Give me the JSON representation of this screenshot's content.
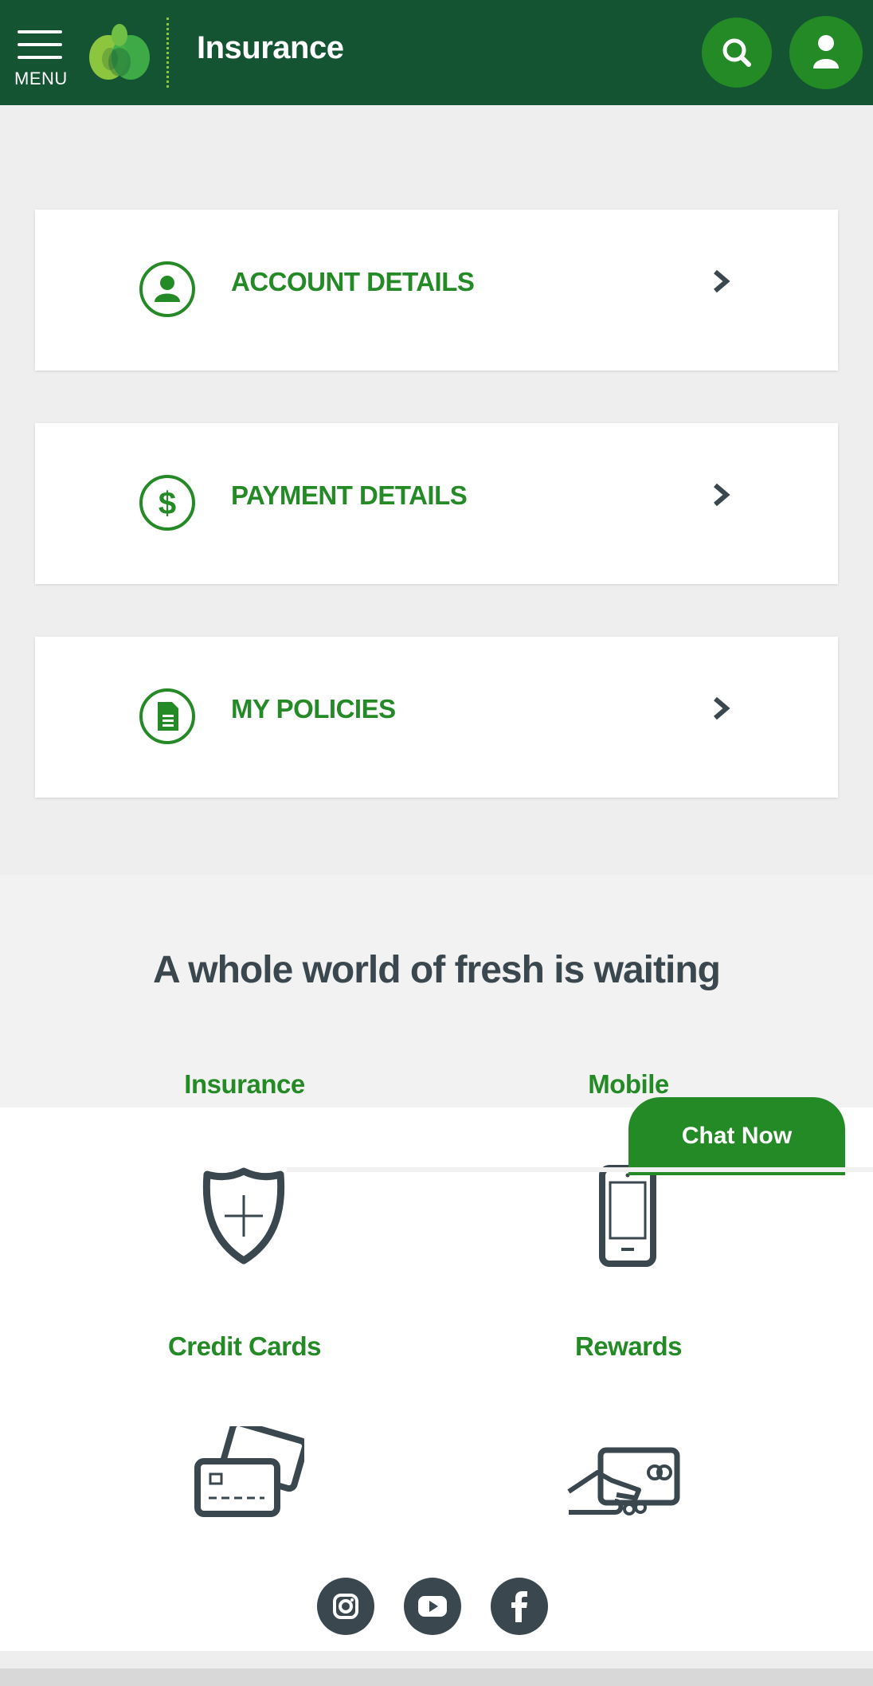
{
  "header": {
    "menu_label": "MENU",
    "brand_title": "Insurance",
    "colors": {
      "bar": "#155433",
      "accent": "#238a26"
    },
    "icons": [
      "hamburger-icon",
      "woolworths-logo-icon",
      "search-icon",
      "user-icon"
    ]
  },
  "account_menu": [
    {
      "label": "ACCOUNT DETAILS",
      "icon": "person-icon"
    },
    {
      "label": "PAYMENT DETAILS",
      "icon": "dollar-icon"
    },
    {
      "label": "MY POLICIES",
      "icon": "document-icon"
    }
  ],
  "promo": {
    "headline": "A whole world of fresh is waiting",
    "services": [
      {
        "label": "Insurance",
        "icon": "shield-icon"
      },
      {
        "label": "Mobile",
        "icon": "phone-icon"
      },
      {
        "label": "Credit Cards",
        "icon": "credit-cards-icon"
      },
      {
        "label": "Rewards",
        "icon": "rewards-card-icon"
      }
    ]
  },
  "chat": {
    "label": "Chat Now"
  },
  "social": [
    "instagram-icon",
    "youtube-icon",
    "facebook-icon"
  ]
}
